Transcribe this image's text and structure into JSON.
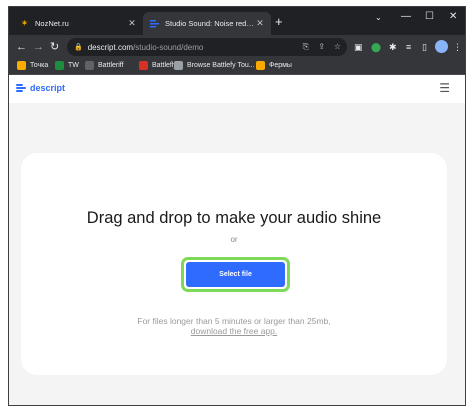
{
  "browser": {
    "tabs": [
      {
        "title": "NozNet.ru",
        "close_glyph": "✕",
        "favicon": "star-logo-icon"
      },
      {
        "title": "Studio Sound: Noise reduction a",
        "close_glyph": "✕",
        "favicon": "descript-logo-icon"
      }
    ],
    "new_tab_glyph": "+",
    "window_controls": {
      "tab_search": "⌄",
      "minimize": "—",
      "maximize": "☐",
      "close": "✕"
    },
    "nav": {
      "back": "←",
      "forward": "→",
      "reload": "↻"
    },
    "address": {
      "domain": "descript.com",
      "path": "/studio-sound/demo",
      "lock_glyph": "🔒"
    },
    "omnibox_icons": [
      "translate-icon",
      "share-icon",
      "star-icon"
    ],
    "omnibox_glyphs": [
      "⎘",
      "⇪",
      "☆"
    ],
    "toolbar_glyphs": [
      "▣",
      "⬤",
      "✱",
      "≡",
      "▯",
      "⋮"
    ],
    "bookmarks": [
      "Точка",
      "TW",
      "Battleriff",
      "Battlefly",
      "Browse Battlefy Tou...",
      "Фермы"
    ]
  },
  "site": {
    "logo_text": "descript",
    "menu_glyph": "☰"
  },
  "upload": {
    "heading": "Drag and drop to make your audio shine",
    "or_text": "or",
    "button_label": "Select file",
    "info_text": "For files longer than 5 minutes or larger than 25mb,",
    "link_text": "download the free app."
  },
  "colors": {
    "accent": "#2f6bff",
    "highlight": "#7ed957",
    "browser_bg": "#202124"
  }
}
